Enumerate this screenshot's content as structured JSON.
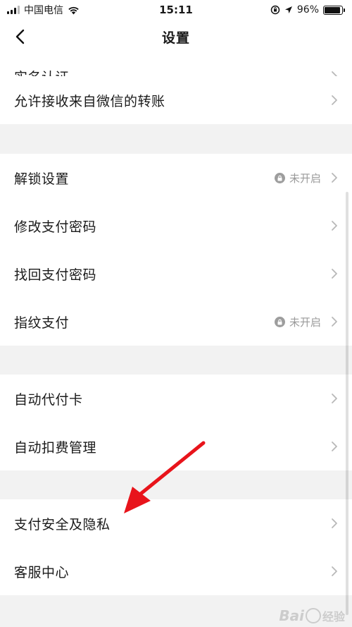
{
  "status_bar": {
    "carrier": "中国电信",
    "time": "15:11",
    "battery": "96%",
    "icons": [
      "signal-icon",
      "wifi-icon",
      "orientation-lock-icon",
      "location-icon",
      "battery-icon"
    ]
  },
  "navbar": {
    "title": "设置"
  },
  "rows": {
    "top_partial": {
      "label": "实名认证"
    },
    "allow_wechat_transfer": {
      "label": "允许接收来自微信的转账"
    },
    "unlock_settings": {
      "label": "解锁设置",
      "status": "未开启"
    },
    "change_pay_password": {
      "label": "修改支付密码"
    },
    "recover_pay_password": {
      "label": "找回支付密码"
    },
    "fingerprint_pay": {
      "label": "指纹支付",
      "status": "未开启"
    },
    "auto_pay_card": {
      "label": "自动代付卡"
    },
    "auto_deduction": {
      "label": "自动扣费管理"
    },
    "pay_security_privacy": {
      "label": "支付安全及隐私"
    },
    "customer_service": {
      "label": "客服中心"
    }
  },
  "watermark": {
    "brand": "Bai",
    "sub": "经验"
  },
  "colors": {
    "arrow": "#e8141b",
    "chevron": "#b8b8b8",
    "status": "#9a9a9a",
    "section_bg": "#f2f2f2"
  }
}
